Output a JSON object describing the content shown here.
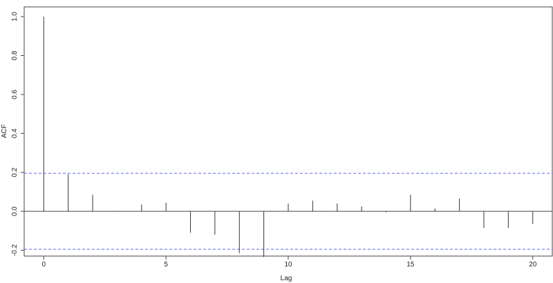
{
  "chart_data": {
    "type": "bar",
    "subtype": "acf-stem",
    "title": "",
    "xlabel": "Lag",
    "ylabel": "ACF",
    "xlim": [
      -0.8,
      20.8
    ],
    "ylim": [
      -0.23,
      1.05
    ],
    "x_ticks": [
      "0",
      "5",
      "10",
      "15",
      "20"
    ],
    "y_ticks": [
      "-0.2",
      "0.0",
      "0.2",
      "0.4",
      "0.6",
      "0.8",
      "1.0"
    ],
    "lags": [
      0,
      1,
      2,
      3,
      4,
      5,
      6,
      7,
      8,
      9,
      10,
      11,
      12,
      13,
      14,
      15,
      16,
      17,
      18,
      19,
      20
    ],
    "values": [
      1.0,
      0.19,
      0.085,
      0.002,
      0.035,
      0.045,
      -0.11,
      -0.12,
      -0.215,
      -0.235,
      0.04,
      0.055,
      0.04,
      0.025,
      -0.005,
      0.085,
      0.015,
      0.065,
      -0.085,
      -0.085,
      -0.065
    ],
    "confidence_bounds": [
      0.195,
      -0.195
    ],
    "colors": {
      "stem": "#333333",
      "ci": "#5b64f0",
      "axis": "#444444"
    }
  }
}
